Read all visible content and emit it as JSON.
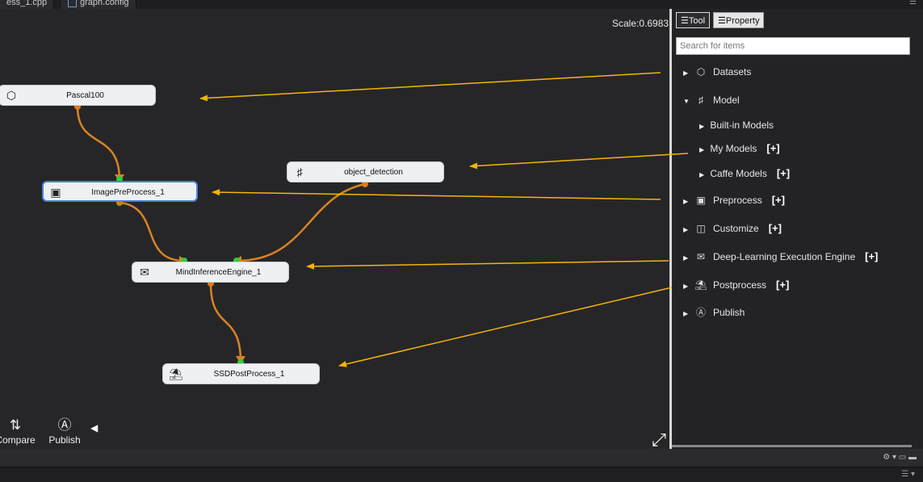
{
  "tabs": [
    {
      "label": "ess_1.cpp"
    },
    {
      "label": "graph.config"
    }
  ],
  "canvas": {
    "scale_label": "Scale:0.6983",
    "nodes": [
      {
        "id": "pascal",
        "label": "Pascal100",
        "icon": "cube-icon"
      },
      {
        "id": "prep",
        "label": "ImagePreProcess_1",
        "icon": "preprocess-icon"
      },
      {
        "id": "objdet",
        "label": "object_detection",
        "icon": "model-icon"
      },
      {
        "id": "engine",
        "label": "MindInferenceEngine_1",
        "icon": "engine-icon"
      },
      {
        "id": "post",
        "label": "SSDPostProcess_1",
        "icon": "postprocess-icon"
      }
    ],
    "bottom_tools": [
      {
        "label": "Compare",
        "icon": "compare-icon"
      },
      {
        "label": "Publish",
        "icon": "publish-icon"
      }
    ]
  },
  "panel": {
    "tab_tool": "Tool",
    "tab_property": "Property",
    "search_placeholder": "Search for items",
    "tree": [
      {
        "label": "Datasets",
        "icon": "cube-icon",
        "expanded": false
      },
      {
        "label": "Model",
        "icon": "model-icon",
        "expanded": true
      },
      {
        "label": "Built-in Models",
        "child": true
      },
      {
        "label": "My Models",
        "child": true,
        "plus": "[+]"
      },
      {
        "label": "Caffe Models",
        "child": true,
        "plus": "[+]"
      },
      {
        "label": "Preprocess",
        "icon": "preprocess-icon",
        "plus": "[+]"
      },
      {
        "label": "Customize",
        "icon": "customize-icon",
        "plus": "[+]"
      },
      {
        "label": "Deep-Learning Execution Engine",
        "icon": "engine-icon",
        "plus": "[+]"
      },
      {
        "label": "Postprocess",
        "icon": "postprocess-icon",
        "plus": "[+]"
      },
      {
        "label": "Publish",
        "icon": "publish-icon"
      }
    ]
  },
  "colors": {
    "annotation_arrow": "#f5b40a",
    "wire": "#d98324",
    "port_in": "#2ecc40",
    "port_out": "#e0791e",
    "selection": "#4f7fe0"
  }
}
